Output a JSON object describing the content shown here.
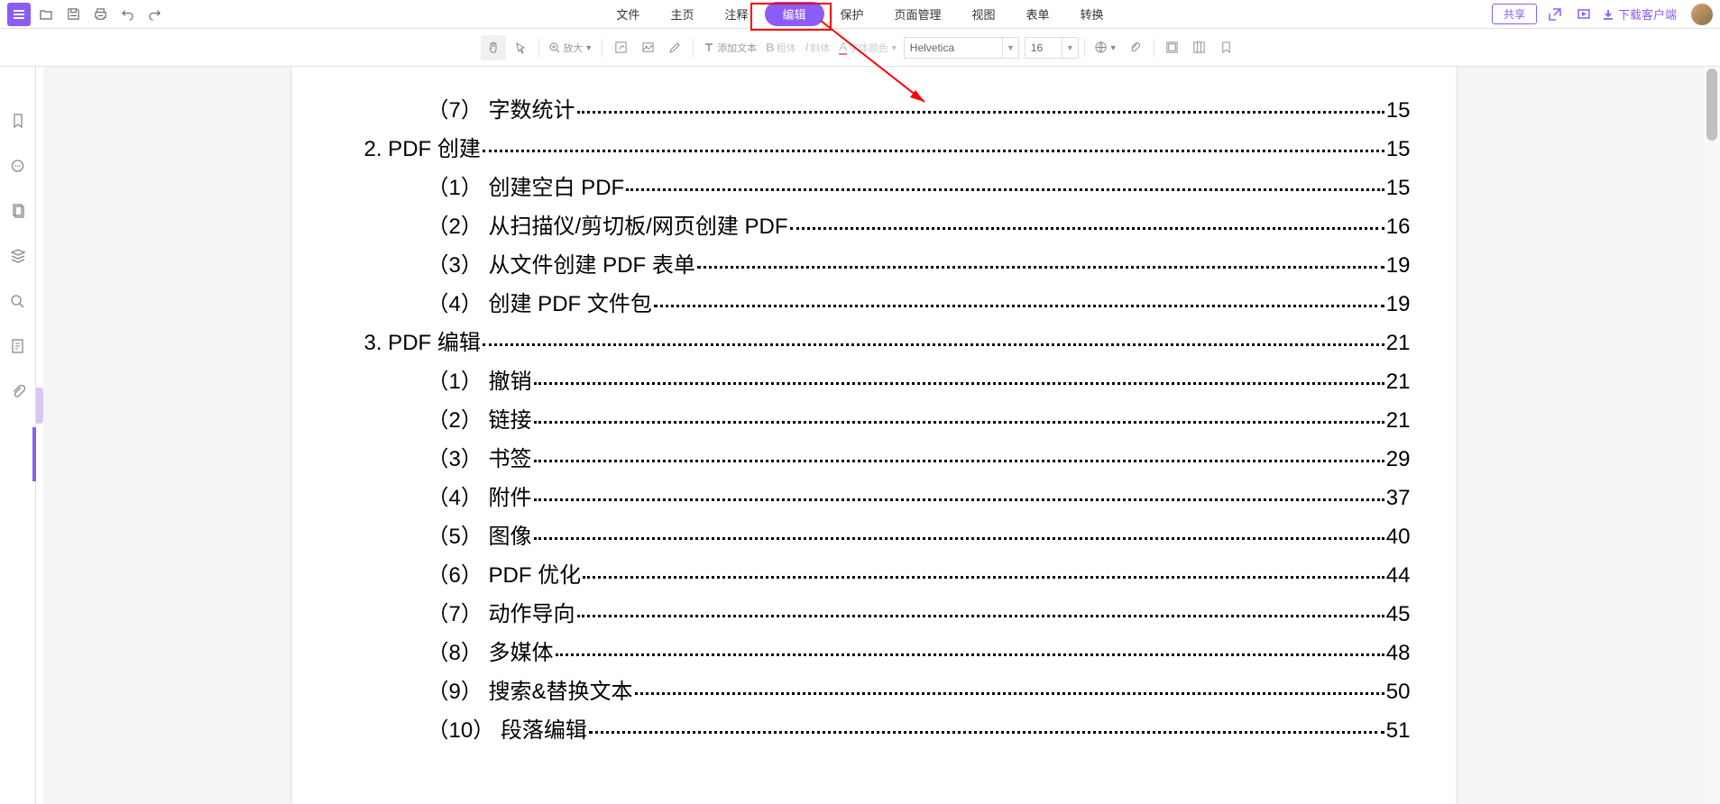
{
  "topMenu": {
    "items": [
      "文件",
      "主页",
      "注释",
      "编辑",
      "保护",
      "页面管理",
      "视图",
      "表单",
      "转换"
    ],
    "activeIndex": 3
  },
  "topRight": {
    "share": "共享",
    "download": "下载客户端"
  },
  "toolbar": {
    "zoomLabel": "放大",
    "addText": "添加文本",
    "bold": "粗体",
    "italic": "斜体",
    "fontColor": "字体颜色",
    "fontName": "Helvetica",
    "fontSize": "16"
  },
  "toc": [
    {
      "level": 2,
      "prefix": "（7）",
      "title": "字数统计",
      "page": "15"
    },
    {
      "level": 1,
      "prefix": "2.",
      "title": "PDF 创建",
      "page": "15"
    },
    {
      "level": 2,
      "prefix": "（1）",
      "title": "创建空白 PDF",
      "page": "15"
    },
    {
      "level": 2,
      "prefix": "（2）",
      "title": "从扫描仪/剪切板/网页创建 PDF",
      "page": "16"
    },
    {
      "level": 2,
      "prefix": "（3）",
      "title": "从文件创建 PDF 表单",
      "page": "19"
    },
    {
      "level": 2,
      "prefix": "（4）",
      "title": "创建 PDF 文件包",
      "page": "19"
    },
    {
      "level": 1,
      "prefix": "3.",
      "title": "PDF 编辑",
      "page": "21"
    },
    {
      "level": 2,
      "prefix": "（1）",
      "title": "撤销",
      "page": "21"
    },
    {
      "level": 2,
      "prefix": "（2）",
      "title": "链接",
      "page": "21"
    },
    {
      "level": 2,
      "prefix": "（3）",
      "title": "书签",
      "page": "29"
    },
    {
      "level": 2,
      "prefix": "（4）",
      "title": "附件",
      "page": "37"
    },
    {
      "level": 2,
      "prefix": "（5）",
      "title": "图像",
      "page": "40"
    },
    {
      "level": 2,
      "prefix": "（6）",
      "title": "PDF 优化",
      "page": "44"
    },
    {
      "level": 2,
      "prefix": "（7）",
      "title": "动作导向",
      "page": "45"
    },
    {
      "level": 2,
      "prefix": "（8）",
      "title": "多媒体",
      "page": "48"
    },
    {
      "level": 2,
      "prefix": "（9）",
      "title": "搜索&替换文本",
      "page": "50"
    },
    {
      "level": 2,
      "prefix": "（10）",
      "title": "段落编辑",
      "page": "51"
    }
  ]
}
